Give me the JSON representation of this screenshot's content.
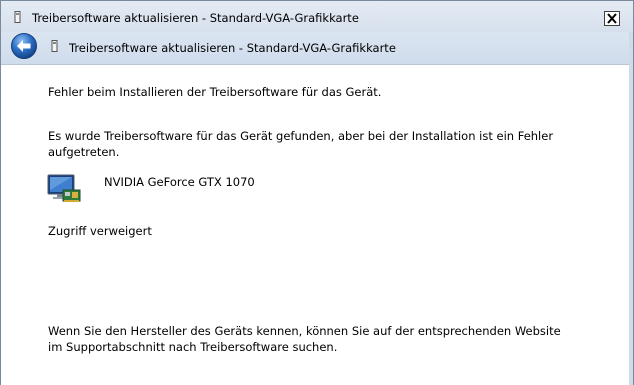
{
  "window": {
    "title": "Treibersoftware aktualisieren - Standard-VGA-Grafikkarte",
    "close_icon": "close-icon"
  },
  "navbar": {
    "back_icon": "back-arrow-icon",
    "title": "Treibersoftware aktualisieren - Standard-VGA-Grafikkarte"
  },
  "content": {
    "heading": "Fehler beim Installieren der Treibersoftware für das Gerät.",
    "description": "Es wurde Treibersoftware für das Gerät gefunden, aber bei der Installation ist ein Fehler aufgetreten.",
    "device": {
      "icon": "display-adapter-icon",
      "name": "NVIDIA GeForce GTX 1070"
    },
    "error": "Zugriff verweigert",
    "help": "Wenn Sie den Hersteller des Geräts kennen, können Sie auf der entsprechenden Website im Supportabschnitt nach Treibersoftware suchen."
  },
  "colors": {
    "titlebar": "#dbe4ef",
    "back_button": "#2d6fc4"
  }
}
